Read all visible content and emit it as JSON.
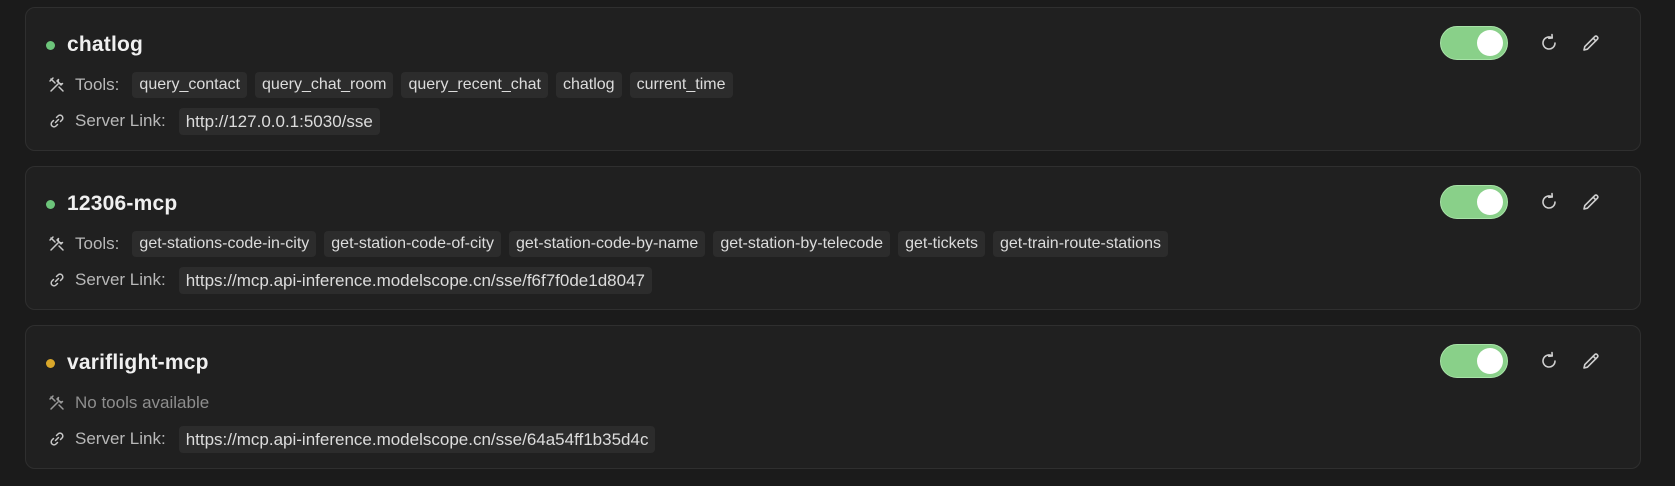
{
  "servers": [
    {
      "name": "chatlog",
      "status_color": "#6cc47a",
      "enabled": true,
      "tools_label": "Tools:",
      "tools": [
        "query_contact",
        "query_chat_room",
        "query_recent_chat",
        "chatlog",
        "current_time"
      ],
      "link_label": "Server Link:",
      "link": "http://127.0.0.1:5030/sse"
    },
    {
      "name": "12306-mcp",
      "status_color": "#6cc47a",
      "enabled": true,
      "tools_label": "Tools:",
      "tools": [
        "get-stations-code-in-city",
        "get-station-code-of-city",
        "get-station-code-by-name",
        "get-station-by-telecode",
        "get-tickets",
        "get-train-route-stations"
      ],
      "link_label": "Server Link:",
      "link": "https://mcp.api-inference.modelscope.cn/sse/f6f7f0de1d8047"
    },
    {
      "name": "variflight-mcp",
      "status_color": "#d9a72a",
      "enabled": true,
      "no_tools_text": "No tools available",
      "tools": [],
      "link_label": "Server Link:",
      "link": "https://mcp.api-inference.modelscope.cn/sse/64a54ff1b35d4c"
    }
  ],
  "icons": {
    "tools": "tools-icon",
    "link": "link-icon",
    "refresh": "refresh-icon",
    "edit": "pencil-icon"
  },
  "colors": {
    "toggle_on": "#89d089",
    "tag_bg": "#2c2c2c",
    "card_bg": "#202020"
  }
}
